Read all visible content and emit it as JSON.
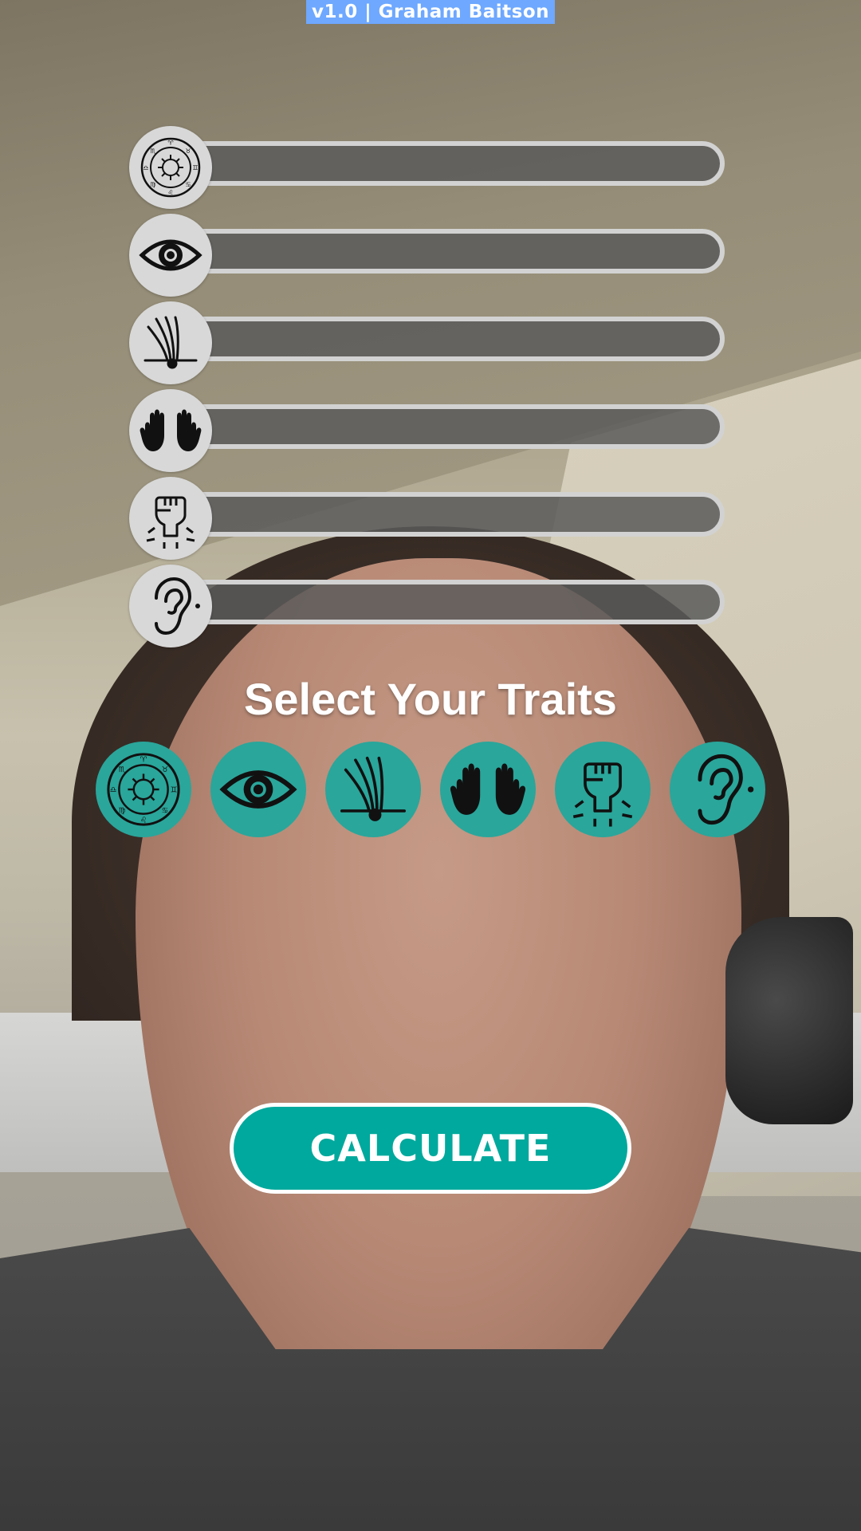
{
  "header": {
    "version_label": "v1.0 | Graham Baitson"
  },
  "trait_bars": [
    {
      "trait": "astrology",
      "icon": "zodiac-wheel-icon",
      "level": 0
    },
    {
      "trait": "eye",
      "icon": "eye-icon",
      "level": 0
    },
    {
      "trait": "hair",
      "icon": "hair-follicle-icon",
      "level": 0
    },
    {
      "trait": "hands",
      "icon": "hands-icon",
      "level": 0
    },
    {
      "trait": "strength",
      "icon": "raised-fist-icon",
      "level": 0
    },
    {
      "trait": "ear",
      "icon": "ear-icon",
      "level": 0
    }
  ],
  "selector": {
    "title": "Select Your Traits",
    "buttons": [
      {
        "trait": "astrology",
        "icon": "zodiac-wheel-icon"
      },
      {
        "trait": "eye",
        "icon": "eye-icon"
      },
      {
        "trait": "hair",
        "icon": "hair-follicle-icon"
      },
      {
        "trait": "hands",
        "icon": "hands-icon"
      },
      {
        "trait": "strength",
        "icon": "raised-fist-icon"
      },
      {
        "trait": "ear",
        "icon": "ear-icon"
      }
    ]
  },
  "actions": {
    "calculate_label": "CALCULATE"
  },
  "colors": {
    "accent": "#00a99d",
    "banner": "#6ea8ff",
    "bar_track": "#5a5a5a",
    "icon_bg": "#d8d8d8"
  }
}
